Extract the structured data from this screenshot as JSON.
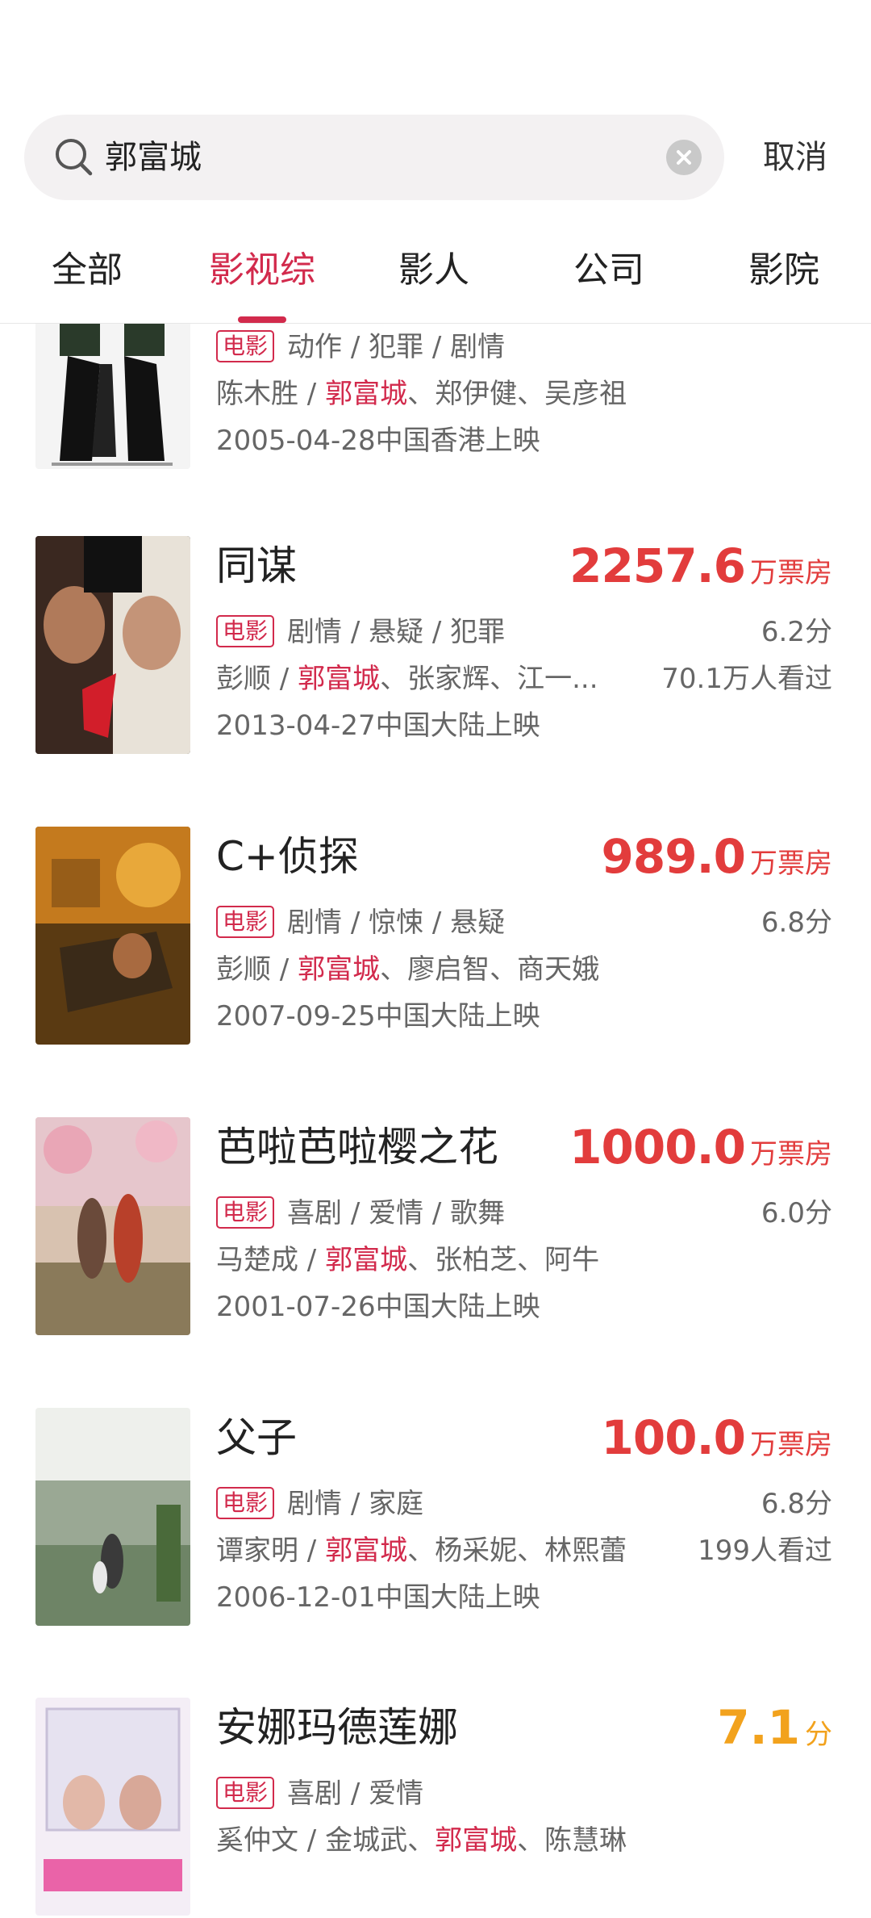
{
  "search": {
    "query": "郭富城",
    "cancel_label": "取消"
  },
  "tabs": [
    {
      "label": "全部"
    },
    {
      "label": "影视综"
    },
    {
      "label": "影人"
    },
    {
      "label": "公司"
    },
    {
      "label": "影院"
    }
  ],
  "active_tab": "影视综",
  "icons": {
    "search": "search-icon",
    "clear": "clear-icon"
  },
  "colors": {
    "accent": "#d22a4c",
    "box_office": "#e23c3c",
    "score": "#f2a21d"
  },
  "items": [
    {
      "title": "",
      "tag": "电影",
      "genres": "动作 / 犯罪 / 剧情",
      "director": "陈木胜",
      "sep": " / ",
      "cast_before": "",
      "highlight": "郭富城",
      "cast_after": "、郑伊健、吴彦祖",
      "release": "2005-04-28中国香港上映"
    },
    {
      "title": "同谋",
      "box_value": "2257.6",
      "box_unit": "万票房",
      "tag": "电影",
      "genres": "剧情 / 悬疑 / 犯罪",
      "score": "6.2分",
      "director": "彭顺",
      "sep": " / ",
      "cast_before": "",
      "highlight": "郭富城",
      "cast_after": "、张家辉、江一...",
      "watched": "70.1万人看过",
      "release": "2013-04-27中国大陆上映"
    },
    {
      "title": "C+侦探",
      "box_value": "989.0",
      "box_unit": "万票房",
      "tag": "电影",
      "genres": "剧情 / 惊悚 / 悬疑",
      "score": "6.8分",
      "director": "彭顺",
      "sep": " / ",
      "cast_before": "",
      "highlight": "郭富城",
      "cast_after": "、廖启智、商天娥",
      "release": "2007-09-25中国大陆上映"
    },
    {
      "title": "芭啦芭啦樱之花",
      "box_value": "1000.0",
      "box_unit": "万票房",
      "tag": "电影",
      "genres": "喜剧 / 爱情 / 歌舞",
      "score": "6.0分",
      "director": "马楚成",
      "sep": " / ",
      "cast_before": "",
      "highlight": "郭富城",
      "cast_after": "、张柏芝、阿牛",
      "release": "2001-07-26中国大陆上映"
    },
    {
      "title": "父子",
      "box_value": "100.0",
      "box_unit": "万票房",
      "tag": "电影",
      "genres": "剧情 / 家庭",
      "score": "6.8分",
      "director": "谭家明",
      "sep": " / ",
      "cast_before": "",
      "highlight": "郭富城",
      "cast_after": "、杨采妮、林熙蕾",
      "watched": "199人看过",
      "release": "2006-12-01中国大陆上映"
    },
    {
      "title": "安娜玛德莲娜",
      "score_value": "7.1",
      "score_unit": "分",
      "tag": "电影",
      "genres": "喜剧 / 爱情",
      "director": "奚仲文",
      "sep": " / ",
      "cast_before": "金城武、",
      "highlight": "郭富城",
      "cast_after": "、陈慧琳",
      "release": ""
    }
  ]
}
